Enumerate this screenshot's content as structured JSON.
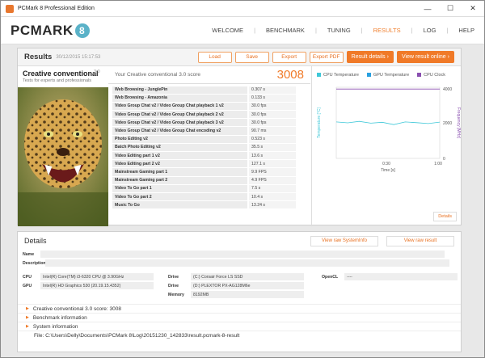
{
  "window": {
    "title": "PCMark 8 Professional Edition",
    "minimize": "—",
    "maximize": "☐",
    "close": "✕"
  },
  "header": {
    "logo": "PCMARK",
    "logo_badge": "8",
    "nav": [
      "WELCOME",
      "BENCHMARK",
      "TUNING",
      "RESULTS",
      "LOG",
      "HELP"
    ],
    "active_nav": "RESULTS"
  },
  "results": {
    "title": "Results",
    "date": "30/12/2015 15:17:53",
    "buttons": {
      "load": "Load",
      "save": "Save",
      "export": "Export",
      "export_pdf": "Export PDF",
      "result_details": "Result details",
      "view_online": "View result online"
    },
    "benchmark_name": "Creative conventional",
    "benchmark_version": "3.0",
    "benchmark_sub": "Tests for experts and professionals",
    "score_label": "Your Creative conventional 3.0 score",
    "score": "3008",
    "rows": [
      {
        "name": "Web Browsing - JunglePin",
        "value": "0.307 s"
      },
      {
        "name": "Web Browsing - Amazonia",
        "value": "0.133 s"
      },
      {
        "name": "Video Group Chat v2 / Video Group Chat playback 1 v2",
        "value": "30.0 fps"
      },
      {
        "name": "Video Group Chat v2 / Video Group Chat playback 2 v2",
        "value": "30.0 fps"
      },
      {
        "name": "Video Group Chat v2 / Video Group Chat playback 3 v2",
        "value": "30.0 fps"
      },
      {
        "name": "Video Group Chat v2 / Video Group Chat encoding v2",
        "value": "90.7 ms"
      },
      {
        "name": "Photo Editing v2",
        "value": "0.523 s"
      },
      {
        "name": "Batch Photo Editing v2",
        "value": "35.5 s"
      },
      {
        "name": "Video Editing part 1 v2",
        "value": "13.6 s"
      },
      {
        "name": "Video Editing part 2 v2",
        "value": "127.1 s"
      },
      {
        "name": "Mainstream Gaming part 1",
        "value": "9.9 FPS"
      },
      {
        "name": "Mainstream Gaming part 2",
        "value": "4.9 FPS"
      },
      {
        "name": "Video To Go part 1",
        "value": "7.5 s"
      },
      {
        "name": "Video To Go part 2",
        "value": "10.4 s"
      },
      {
        "name": "Music To Go",
        "value": "13.24 s"
      }
    ],
    "details_button": "Details"
  },
  "chart_data": {
    "type": "line",
    "legend": [
      "CPU Temperature",
      "GPU Temperature",
      "CPU Clock"
    ],
    "colors": {
      "cpu_temp": "#3fc8d8",
      "gpu_temp": "#29a0e0",
      "cpu_clock": "#8a4fb0"
    },
    "left_axis_label": "Temperature [°C]",
    "right_axis_label": "Frequency [MHz]",
    "right_ticks": [
      "4000",
      "2000",
      "0"
    ],
    "x_ticks": [
      "0:30",
      "1:00"
    ],
    "xlabel": "Time [s]",
    "cpu_clock": [
      3900,
      3900,
      3900,
      3900,
      3900,
      3900,
      3900,
      3900,
      3900,
      3900
    ],
    "cpu_temp": [
      2050,
      2000,
      2080,
      1980,
      2030,
      1900,
      2050,
      2010,
      1960,
      2040
    ]
  },
  "details": {
    "title": "Details",
    "view_sysinfo": "View raw SystemInfo",
    "view_result": "View raw result",
    "name_label": "Name",
    "description_label": "Description",
    "cpu_label": "CPU",
    "cpu": "Intel(R) Core(TM) i3-6320 CPU @ 3.90GHz",
    "gpu_label": "GPU",
    "gpu": "Intel(R) HD Graphics 530 (20.19.15.4352)",
    "drive_label": "Drive",
    "drive1": "(C:) Corsair Force LS SSD",
    "drive2": "(D:) PLEXTOR PX-AG128M6e",
    "memory_label": "Memory",
    "memory": "8192MB",
    "opencl_label": "OpenCL",
    "opencl": "----",
    "expanders": [
      "Creative conventional 3.0 score: 3008",
      "Benchmark information",
      "System information"
    ],
    "file_path": "File: C:\\Users\\Delly\\Documents\\PCMark 8\\Log\\20151230_142833\\result.pcmark-8-result"
  }
}
